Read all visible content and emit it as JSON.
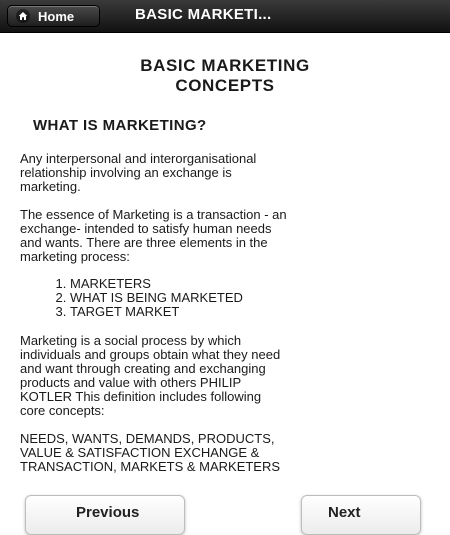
{
  "header": {
    "home_label": "Home",
    "title": "BASIC MARKETI..."
  },
  "icons": {
    "home": "home-icon"
  },
  "colors": {
    "header_bg": "#1a1a1a",
    "header_text": "#ffffff",
    "body_text": "#1a1a1a",
    "page_bg": "#ffffff"
  },
  "content": {
    "title_line1": "BASIC MARKETING",
    "title_line2": "CONCEPTS",
    "heading": "WHAT IS MARKETING?",
    "paragraph1_lines": [
      "Any interpersonal and interorganisational",
      "relationship involving an exchange is",
      "marketing."
    ],
    "paragraph2_lines": [
      "The essence of Marketing is a transaction - an",
      "exchange- intended to satisfy human needs",
      "and wants. There are three elements in the",
      "marketing process:"
    ],
    "list_items": [
      "MARKETERS",
      "WHAT IS BEING MARKETED",
      "TARGET MARKET"
    ],
    "paragraph3_lines": [
      "Marketing is a social process by which",
      "individuals and groups obtain what they need",
      "and want through creating and exchanging",
      "products and value with others PHILIP",
      "KOTLER This definition includes following",
      "core concepts:"
    ],
    "paragraph4_lines": [
      "NEEDS, WANTS, DEMANDS, PRODUCTS,",
      "VALUE & SATISFACTION EXCHANGE &",
      "TRANSACTION, MARKETS & MARKETERS"
    ]
  },
  "navigation": {
    "previous_label": "Previous",
    "next_label": "Next"
  }
}
